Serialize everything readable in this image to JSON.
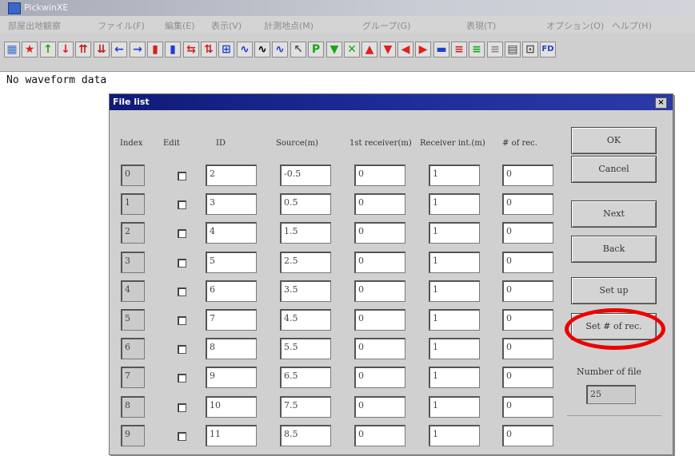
{
  "window": {
    "title": "PickwinXE"
  },
  "menu": [
    "部屋出地観察",
    "ファイル(F)",
    "編集(E)",
    "表示(V)",
    "計測地点(M)",
    "グループ(G)",
    "表現(T)",
    "オプション(O)",
    "ヘルプ(H)"
  ],
  "toolbar": {
    "buttons": [
      {
        "icon": "grid-icon",
        "color": "#3d6fd1"
      },
      {
        "icon": "star-icon",
        "color": "#e02020"
      },
      {
        "icon": "up-arrow-green-icon",
        "color": "#15a915"
      },
      {
        "icon": "down-arrow-red-icon",
        "color": "#e02020"
      },
      {
        "icon": "double-up-arrow-icon",
        "color": "#c02020"
      },
      {
        "icon": "double-down-arrow-icon",
        "color": "#c02020"
      },
      {
        "icon": "left-arrow-icon",
        "color": "#1f3fd0"
      },
      {
        "icon": "right-arrow-icon",
        "color": "#1f3fd0"
      },
      {
        "icon": "block-red-blue-icon",
        "color": "#d02020"
      },
      {
        "icon": "block-blue-red-icon",
        "color": "#1f3fd0"
      },
      {
        "icon": "shift-icon",
        "color": "#d02020"
      },
      {
        "icon": "merge-icon",
        "color": "#d02020"
      },
      {
        "icon": "compress-icon",
        "color": "#1f3fd0"
      },
      {
        "icon": "waveform-icon",
        "color": "#1f3fd0"
      },
      {
        "icon": "waveform-bold-icon",
        "color": "#000000"
      },
      {
        "icon": "waveform-alt-icon",
        "color": "#1f3fd0"
      },
      {
        "icon": "pointer-icon",
        "color": "#555555"
      },
      {
        "icon": "pick-p-icon",
        "color": "#15a915"
      },
      {
        "icon": "down-triangle-green-icon",
        "color": "#15a915"
      },
      {
        "icon": "cross-icon",
        "color": "#15a915"
      },
      {
        "icon": "up-triangle-red-icon",
        "color": "#e02020"
      },
      {
        "icon": "down-triangle-red-icon",
        "color": "#e02020"
      },
      {
        "icon": "left-triangle-red-icon",
        "color": "#e02020"
      },
      {
        "icon": "right-triangle-red-icon",
        "color": "#e02020"
      },
      {
        "icon": "color-bars-icon",
        "color": "#1f3fd0"
      },
      {
        "icon": "color-bars-alt-icon",
        "color": "#d02020"
      },
      {
        "icon": "color-bars-green-icon",
        "color": "#15a915"
      },
      {
        "icon": "grey-bars-icon",
        "color": "#888888"
      },
      {
        "icon": "list-icon",
        "color": "#444444"
      },
      {
        "icon": "spectrum-icon",
        "color": "#555555"
      },
      {
        "icon": "fd-icon",
        "color": "#1f3fd0"
      }
    ],
    "text_glyphs": {
      "pick_p": "P",
      "fd": "FD"
    }
  },
  "status": {
    "text": "No waveform data"
  },
  "dialog": {
    "title": "File list",
    "close_glyph": "×",
    "headers": {
      "index": "Index",
      "edit": "Edit",
      "id": "ID",
      "source": "Source(m)",
      "first_receiver": "1st receiver(m)",
      "receiver_int": "Receiver int.(m)",
      "num_rec": "# of rec."
    },
    "rows": [
      {
        "index": "0",
        "id": "2",
        "source": "-0.5",
        "first": "0",
        "interval": "1",
        "count": "0"
      },
      {
        "index": "1",
        "id": "3",
        "source": "0.5",
        "first": "0",
        "interval": "1",
        "count": "0"
      },
      {
        "index": "2",
        "id": "4",
        "source": "1.5",
        "first": "0",
        "interval": "1",
        "count": "0"
      },
      {
        "index": "3",
        "id": "5",
        "source": "2.5",
        "first": "0",
        "interval": "1",
        "count": "0"
      },
      {
        "index": "4",
        "id": "6",
        "source": "3.5",
        "first": "0",
        "interval": "1",
        "count": "0"
      },
      {
        "index": "5",
        "id": "7",
        "source": "4.5",
        "first": "0",
        "interval": "1",
        "count": "0"
      },
      {
        "index": "6",
        "id": "8",
        "source": "5.5",
        "first": "0",
        "interval": "1",
        "count": "0"
      },
      {
        "index": "7",
        "id": "9",
        "source": "6.5",
        "first": "0",
        "interval": "1",
        "count": "0"
      },
      {
        "index": "8",
        "id": "10",
        "source": "7.5",
        "first": "0",
        "interval": "1",
        "count": "0"
      },
      {
        "index": "9",
        "id": "11",
        "source": "8.5",
        "first": "0",
        "interval": "1",
        "count": "0"
      }
    ],
    "buttons": {
      "ok": "OK",
      "cancel": "Cancel",
      "next": "Next",
      "back": "Back",
      "setup": "Set up",
      "set_num_rec": "Set # of rec."
    },
    "file_count_label": "Number of file",
    "file_count_value": "25",
    "highlight_color": "#ee0000"
  }
}
